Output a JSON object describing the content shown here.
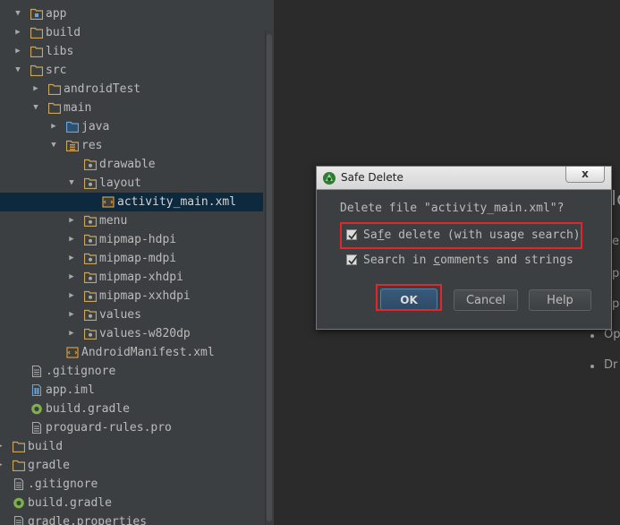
{
  "project_tree": {
    "items": [
      {
        "label": "app",
        "arrow": "▼",
        "icon": "module-folder"
      },
      {
        "label": "build",
        "arrow": "▶",
        "icon": "folder"
      },
      {
        "label": "libs",
        "arrow": "▶",
        "icon": "folder"
      },
      {
        "label": "src",
        "arrow": "▼",
        "icon": "folder"
      },
      {
        "label": "androidTest",
        "arrow": "▶",
        "icon": "folder"
      },
      {
        "label": "main",
        "arrow": "▼",
        "icon": "folder"
      },
      {
        "label": "java",
        "arrow": "▶",
        "icon": "source-folder"
      },
      {
        "label": "res",
        "arrow": "▼",
        "icon": "resource-folder"
      },
      {
        "label": "drawable",
        "arrow": "",
        "icon": "package-folder"
      },
      {
        "label": "layout",
        "arrow": "▼",
        "icon": "package-folder"
      },
      {
        "label": "activity_main.xml",
        "arrow": "",
        "icon": "xml-file"
      },
      {
        "label": "menu",
        "arrow": "▶",
        "icon": "package-folder"
      },
      {
        "label": "mipmap-hdpi",
        "arrow": "▶",
        "icon": "package-folder"
      },
      {
        "label": "mipmap-mdpi",
        "arrow": "▶",
        "icon": "package-folder"
      },
      {
        "label": "mipmap-xhdpi",
        "arrow": "▶",
        "icon": "package-folder"
      },
      {
        "label": "mipmap-xxhdpi",
        "arrow": "▶",
        "icon": "package-folder"
      },
      {
        "label": "values",
        "arrow": "▶",
        "icon": "package-folder"
      },
      {
        "label": "values-w820dp",
        "arrow": "▶",
        "icon": "package-folder"
      },
      {
        "label": "AndroidManifest.xml",
        "arrow": "",
        "icon": "xml-file"
      },
      {
        "label": ".gitignore",
        "arrow": "",
        "icon": "text-file"
      },
      {
        "label": "app.iml",
        "arrow": "",
        "icon": "iml-file"
      },
      {
        "label": "build.gradle",
        "arrow": "",
        "icon": "gradle-file"
      },
      {
        "label": "proguard-rules.pro",
        "arrow": "",
        "icon": "text-file"
      },
      {
        "label": "build",
        "arrow": "▶",
        "icon": "folder"
      },
      {
        "label": "gradle",
        "arrow": "▶",
        "icon": "folder"
      },
      {
        "label": ".gitignore",
        "arrow": "",
        "icon": "text-file"
      },
      {
        "label": "build.gradle",
        "arrow": "",
        "icon": "gradle-file"
      },
      {
        "label": "gradle.properties",
        "arrow": "",
        "icon": "text-file"
      }
    ],
    "selected_label": "activity_main.xml"
  },
  "editor_background": {
    "fragments": [
      "lc",
      "e",
      "p",
      "p",
      "Op",
      "Dr"
    ]
  },
  "dialog": {
    "title": "Safe Delete",
    "close_symbol": "x",
    "message": "Delete file \"activity_main.xml\"?",
    "checkbox_safe_delete": {
      "label_pre": "Sa",
      "label_mnemonic": "f",
      "label_post": "e delete (with usage search)",
      "checked": true
    },
    "checkbox_search_comments": {
      "label_pre": "Search in ",
      "label_mnemonic": "c",
      "label_post": "omments and strings",
      "checked": true
    },
    "buttons": {
      "ok": "OK",
      "cancel": "Cancel",
      "help": "Help"
    }
  },
  "colors": {
    "highlight_box": "#e0282a",
    "selection": "#0d293e",
    "panel": "#3c3f41",
    "editor": "#2b2b2b"
  }
}
